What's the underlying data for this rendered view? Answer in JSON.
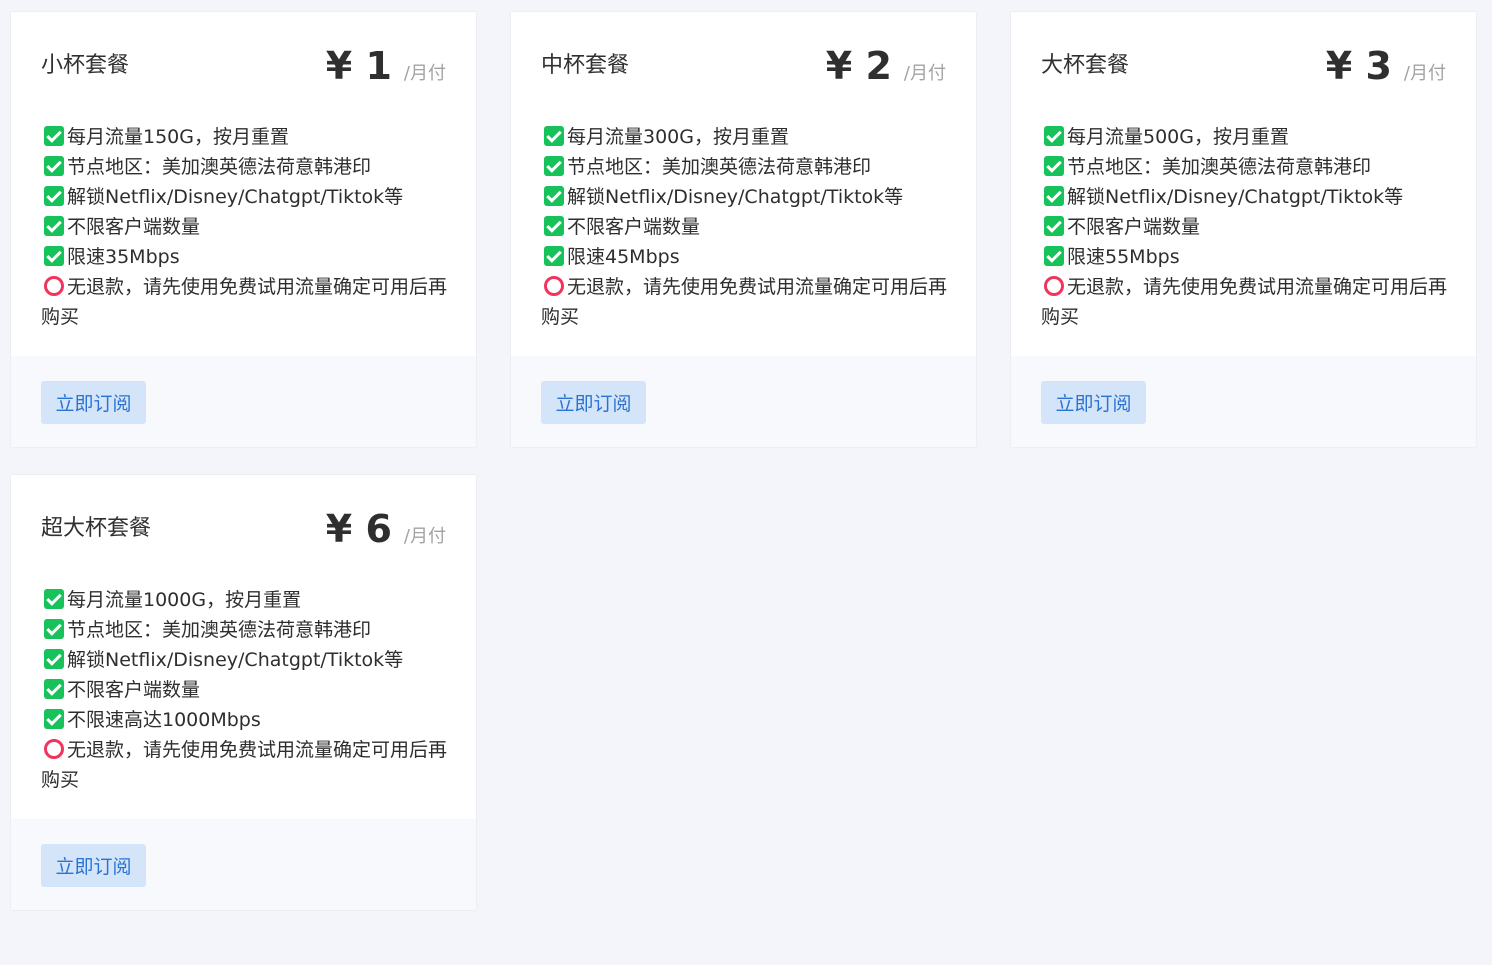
{
  "plans": [
    {
      "name": "小杯套餐",
      "price": "¥ 1",
      "unit": "/月付",
      "features": [
        {
          "icon": "check",
          "text": "每月流量150G，按月重置"
        },
        {
          "icon": "check",
          "text": "节点地区：美加澳英德法荷意韩港印"
        },
        {
          "icon": "check",
          "text": "解锁Netflix/Disney/Chatgpt/Tiktok等"
        },
        {
          "icon": "check",
          "text": "不限客户端数量"
        },
        {
          "icon": "check",
          "text": "限速35Mbps"
        },
        {
          "icon": "circle",
          "text": "无退款，请先使用免费试用流量确定可用后再购买"
        }
      ],
      "button": "立即订阅"
    },
    {
      "name": "中杯套餐",
      "price": "¥ 2",
      "unit": "/月付",
      "features": [
        {
          "icon": "check",
          "text": "每月流量300G，按月重置"
        },
        {
          "icon": "check",
          "text": "节点地区：美加澳英德法荷意韩港印"
        },
        {
          "icon": "check",
          "text": "解锁Netflix/Disney/Chatgpt/Tiktok等"
        },
        {
          "icon": "check",
          "text": "不限客户端数量"
        },
        {
          "icon": "check",
          "text": "限速45Mbps"
        },
        {
          "icon": "circle",
          "text": "无退款，请先使用免费试用流量确定可用后再购买"
        }
      ],
      "button": "立即订阅"
    },
    {
      "name": "大杯套餐",
      "price": "¥ 3",
      "unit": "/月付",
      "features": [
        {
          "icon": "check",
          "text": "每月流量500G，按月重置"
        },
        {
          "icon": "check",
          "text": "节点地区：美加澳英德法荷意韩港印"
        },
        {
          "icon": "check",
          "text": "解锁Netflix/Disney/Chatgpt/Tiktok等"
        },
        {
          "icon": "check",
          "text": "不限客户端数量"
        },
        {
          "icon": "check",
          "text": "限速55Mbps"
        },
        {
          "icon": "circle",
          "text": "无退款，请先使用免费试用流量确定可用后再购买"
        }
      ],
      "button": "立即订阅"
    },
    {
      "name": "超大杯套餐",
      "price": "¥ 6",
      "unit": "/月付",
      "features": [
        {
          "icon": "check",
          "text": "每月流量1000G，按月重置"
        },
        {
          "icon": "check",
          "text": "节点地区：美加澳英德法荷意韩港印"
        },
        {
          "icon": "check",
          "text": "解锁Netflix/Disney/Chatgpt/Tiktok等"
        },
        {
          "icon": "check",
          "text": "不限客户端数量"
        },
        {
          "icon": "check",
          "text": "不限速高达1000Mbps"
        },
        {
          "icon": "circle",
          "text": "无退款，请先使用免费试用流量确定可用后再购买"
        }
      ],
      "button": "立即订阅"
    }
  ],
  "colors": {
    "page_background": "#f4f5fa",
    "card_background": "#ffffff",
    "footer_background": "#f8f9fc",
    "check_icon": "#18c25a",
    "circle_icon": "#f2335e",
    "button_background": "#d4e5f9",
    "button_text": "#2a73d4",
    "unit_text": "#a3a3a3"
  }
}
